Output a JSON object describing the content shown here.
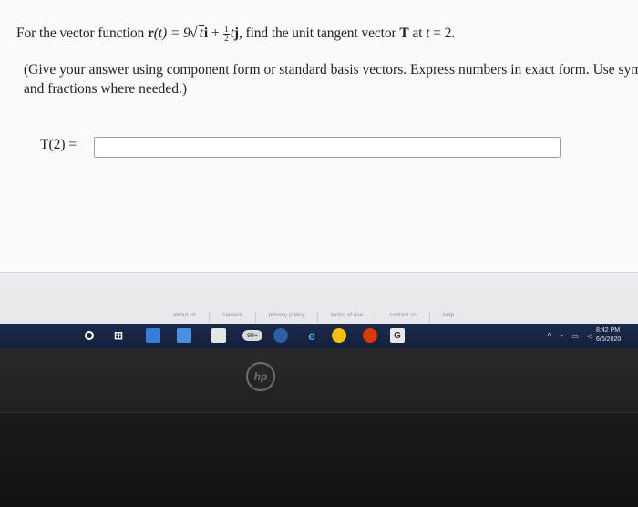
{
  "question": {
    "prefix": "For the vector function ",
    "r_label": "r",
    "r_arg": "(t) = 9",
    "sqrt_arg": "t",
    "i_unit": "i",
    "plus": " + ",
    "frac_num": "1",
    "frac_den": "2",
    "t_var": "t",
    "j_unit": "j",
    "mid": ", find the unit tangent vector ",
    "T_label": "T",
    "at": " at ",
    "t_eq": "t",
    "suffix": " = 2."
  },
  "instructions": {
    "line1": "(Give your answer using component form or standard basis vectors. Express numbers in exact form. Use symbolic no",
    "line2": "and fractions where needed.)"
  },
  "answer": {
    "label": "T(2) =",
    "value": ""
  },
  "footer_links": [
    "about us",
    "careers",
    "privacy policy",
    "terms of use",
    "contact us",
    "help"
  ],
  "taskbar": {
    "badge": "99+",
    "search_tile": "G",
    "clock_time": "8:42 PM",
    "clock_date": "6/6/2020",
    "tray_icons": [
      "chevron-up-icon",
      "network-icon",
      "battery-icon",
      "volume-icon"
    ]
  },
  "brand": {
    "logo_text": "hp"
  },
  "colors": {
    "taskbar": "#14203d",
    "screen_bg": "#fbfbfc",
    "input_border": "#9aa1aa"
  }
}
